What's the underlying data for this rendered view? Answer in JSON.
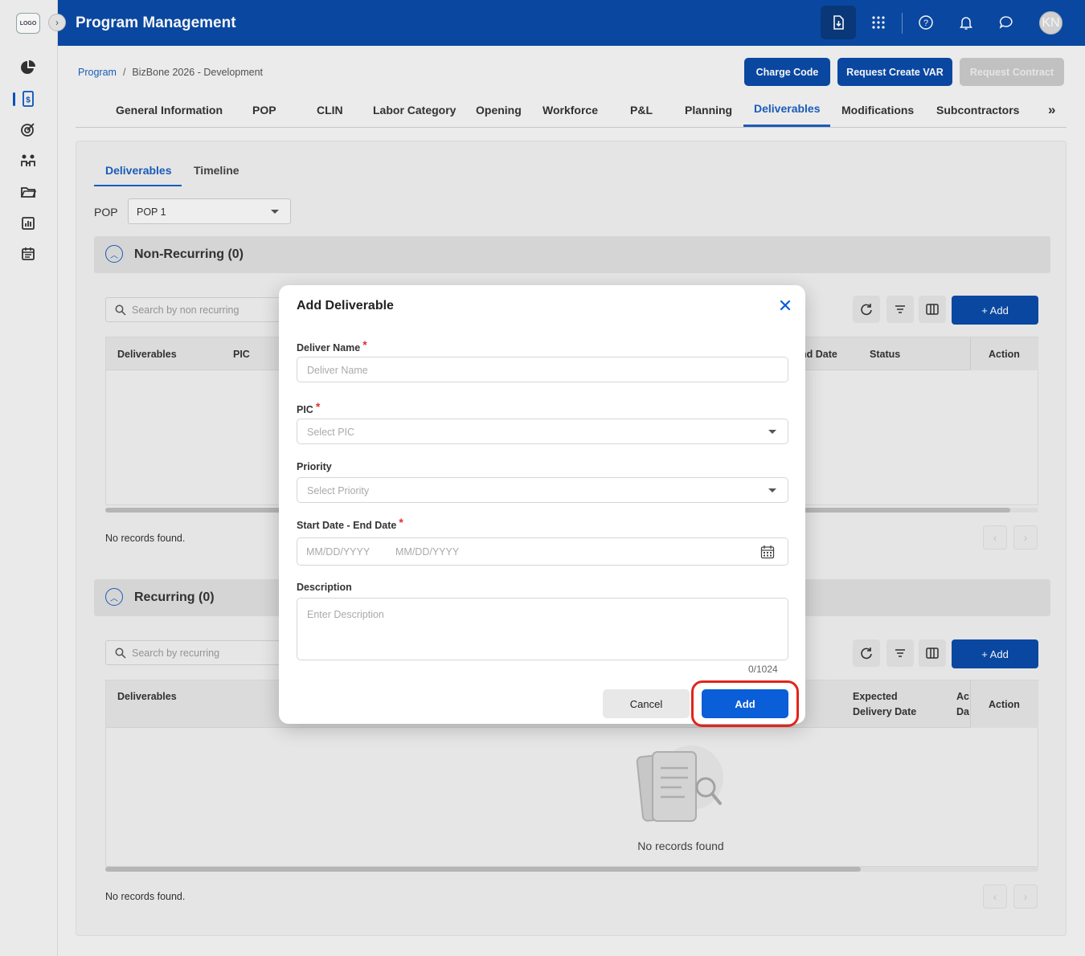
{
  "sidebar": {
    "logo": "LOGO",
    "items": [
      {
        "icon": "pie-chart-icon"
      },
      {
        "icon": "dollar-document-icon",
        "active": true
      },
      {
        "icon": "target-icon"
      },
      {
        "icon": "people-exchange-icon"
      },
      {
        "icon": "folder-icon"
      },
      {
        "icon": "bar-chart-icon"
      },
      {
        "icon": "calendar-icon"
      }
    ]
  },
  "header": {
    "title": "Program Management",
    "avatar_initials": "KN",
    "icons": [
      "download-document-icon",
      "apps-grid-icon",
      "help-icon",
      "bell-icon",
      "chat-icon"
    ]
  },
  "breadcrumb": {
    "root": "Program",
    "separator": "/",
    "current": "BizBone 2026 - Development"
  },
  "top_buttons": {
    "charge_code": "Charge Code",
    "request_var": "Request Create VAR",
    "request_contract": "Request Contract"
  },
  "tabs": [
    "General Information",
    "POP",
    "CLIN",
    "Labor Category",
    "Opening",
    "Workforce",
    "P&L",
    "Planning",
    "Deliverables",
    "Modifications",
    "Subcontractors"
  ],
  "tabs_more": "»",
  "subtabs": [
    "Deliverables",
    "Timeline"
  ],
  "pop": {
    "label": "POP",
    "value": "POP 1"
  },
  "non_recurring": {
    "title": "Non-Recurring (0)",
    "search_placeholder": "Search by non recurring",
    "add_label": "+ Add",
    "columns": [
      "Deliverables",
      "PIC",
      "nd Date",
      "Status",
      "Action"
    ],
    "footer": "No records found.",
    "scroll_fraction": 0.97
  },
  "recurring": {
    "title": "Recurring (0)",
    "search_placeholder": "Search by recurring",
    "add_label": "+ Add",
    "columns": [
      "Deliverables",
      "Expected",
      "Delivery Date",
      "Ac",
      "Da",
      "Action"
    ],
    "empty_text": "No records found",
    "footer": "No records found.",
    "scroll_fraction": 0.81
  },
  "pager": {
    "prev": "‹",
    "next": "›"
  },
  "modal": {
    "title": "Add Deliverable",
    "deliver_name_label": "Deliver Name",
    "deliver_name_placeholder": "Deliver Name",
    "pic_label": "PIC",
    "pic_placeholder": "Select PIC",
    "priority_label": "Priority",
    "priority_placeholder": "Select Priority",
    "date_label": "Start Date - End Date",
    "start_placeholder": "MM/DD/YYYY",
    "end_placeholder": "MM/DD/YYYY",
    "description_label": "Description",
    "description_placeholder": "Enter Description",
    "counter": "0/1024",
    "required_mark": "*",
    "cancel_label": "Cancel",
    "add_label": "Add"
  },
  "colors": {
    "primary": "#0a4aa8",
    "accent": "#1d5fc0",
    "highlight": "#e0261a"
  }
}
